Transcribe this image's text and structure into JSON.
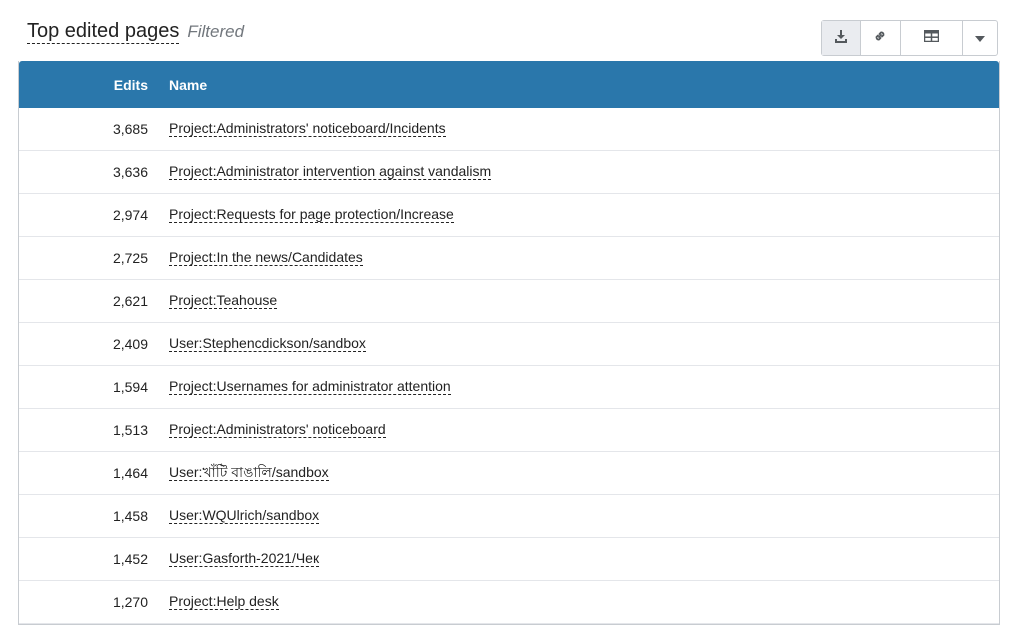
{
  "widget": {
    "title": "Top edited pages",
    "filter_label": "Filtered"
  },
  "toolbar": {
    "download_icon": "download-icon",
    "link_icon": "link-icon",
    "table_icon": "table-icon",
    "caret_icon": "caret-down-icon"
  },
  "table": {
    "columns": {
      "edits": "Edits",
      "name": "Name"
    },
    "header_color": "#2a77ab",
    "rows": [
      {
        "edits": "3,685",
        "name": "Project:Administrators' noticeboard/Incidents"
      },
      {
        "edits": "3,636",
        "name": "Project:Administrator intervention against vandalism"
      },
      {
        "edits": "2,974",
        "name": "Project:Requests for page protection/Increase"
      },
      {
        "edits": "2,725",
        "name": "Project:In the news/Candidates"
      },
      {
        "edits": "2,621",
        "name": "Project:Teahouse"
      },
      {
        "edits": "2,409",
        "name": "User:Stephencdickson/sandbox"
      },
      {
        "edits": "1,594",
        "name": "Project:Usernames for administrator attention"
      },
      {
        "edits": "1,513",
        "name": "Project:Administrators' noticeboard"
      },
      {
        "edits": "1,464",
        "name": "User:খাঁটি বাঙালি/sandbox"
      },
      {
        "edits": "1,458",
        "name": "User:WQUlrich/sandbox"
      },
      {
        "edits": "1,452",
        "name": "User:Gasforth-2021/Чек"
      },
      {
        "edits": "1,270",
        "name": "Project:Help desk"
      }
    ]
  }
}
